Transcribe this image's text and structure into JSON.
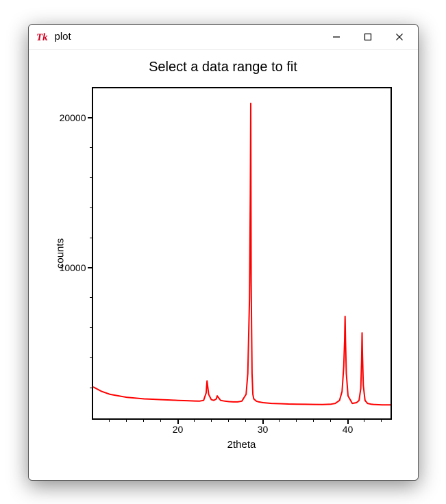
{
  "window": {
    "title": "plot",
    "minimize": "—",
    "maximize": "☐",
    "close": "✕"
  },
  "chart_data": {
    "type": "line",
    "title": "Select a data range to fit",
    "xlabel": "2theta",
    "ylabel": "counts",
    "xlim": [
      10,
      45
    ],
    "ylim": [
      0,
      22000
    ],
    "xticks_major": [
      20,
      30,
      40
    ],
    "yticks_major": [
      10000,
      20000
    ],
    "line_color": "#ff0000",
    "x": [
      10,
      11,
      12,
      13,
      14,
      15,
      16,
      17,
      18,
      19,
      20,
      21,
      22,
      22.5,
      23,
      23.3,
      23.4,
      23.6,
      23.9,
      24.2,
      24.5,
      24.6,
      24.8,
      25,
      25.5,
      26,
      26.5,
      27,
      27.5,
      28,
      28.2,
      28.4,
      28.5,
      28.55,
      28.6,
      28.7,
      28.8,
      28.9,
      29.2,
      29.5,
      30,
      31,
      32,
      33,
      34,
      35,
      36,
      37,
      38,
      38.5,
      39,
      39.3,
      39.5,
      39.6,
      39.65,
      39.7,
      39.8,
      40,
      40.5,
      41,
      41.3,
      41.5,
      41.6,
      41.65,
      41.7,
      41.8,
      42,
      42.3,
      42.7,
      43,
      44,
      45
    ],
    "values": [
      2100,
      1800,
      1600,
      1500,
      1400,
      1350,
      1300,
      1280,
      1250,
      1230,
      1200,
      1180,
      1160,
      1150,
      1200,
      1700,
      2500,
      1600,
      1250,
      1200,
      1300,
      1500,
      1350,
      1200,
      1150,
      1120,
      1100,
      1100,
      1150,
      1600,
      3000,
      8000,
      15000,
      21000,
      9000,
      3000,
      1600,
      1300,
      1150,
      1100,
      1050,
      1000,
      980,
      960,
      950,
      940,
      930,
      920,
      950,
      1000,
      1200,
      1800,
      3500,
      5200,
      6800,
      5200,
      3000,
      1500,
      1000,
      1050,
      1200,
      2000,
      3800,
      5700,
      4200,
      2200,
      1200,
      1000,
      950,
      930,
      900,
      900
    ]
  }
}
